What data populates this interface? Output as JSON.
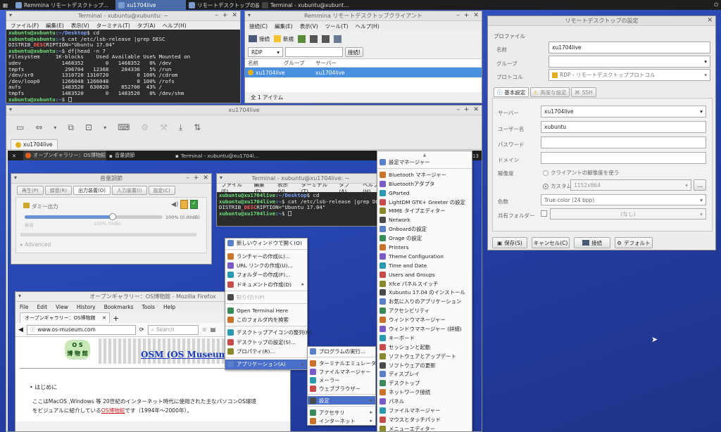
{
  "taskbar": {
    "items": [
      "Remmina リモートデスクトップ...",
      "xu1704live",
      "リモートデスクトップの設定",
      "Terminal - xubuntu@xubunt..."
    ]
  },
  "term1": {
    "title": "Terminal - xubuntu@xubuntu: ~",
    "menu": [
      "ファイル(F)",
      "編集(E)",
      "表示(V)",
      "ターミナル(T)",
      "タブ(A)",
      "ヘルプ(H)"
    ],
    "lines": [
      {
        "user": "xubuntu@xubuntu",
        "path": ":~/Desktop",
        "cmd": "$ cd"
      },
      {
        "user": "xubuntu@xubuntu",
        "path": ":~",
        "cmd": "$ cat /etc/lsb-release |grep DESC"
      },
      {
        "plain_a": "DISTRIB_",
        "plain_b": "DESC",
        "plain_c": "RIPTION=\"Ubuntu 17.04\""
      },
      {
        "user": "xubuntu@xubuntu",
        "path": ":~",
        "cmd": "$ df|head -n 7"
      },
      {
        "plain": "Filesystem     1K-blocks    Used Available Use% Mounted on"
      },
      {
        "plain": "udev             1468352       0   1468352   0% /dev"
      },
      {
        "plain": "tmpfs             296704   12368    284336   5% /run"
      },
      {
        "plain": "/dev/sr0         1310720 1310720         0 100% /cdrom"
      },
      {
        "plain": "/dev/loop0       1266048 1266048         0 100% /rofs"
      },
      {
        "plain": "aufs             1483520  630820    852700  43% /"
      },
      {
        "plain": "tmpfs            1483520       0   1483520   0% /dev/shm"
      },
      {
        "user": "xubuntu@xubuntu",
        "path": ":~",
        "cmd": "$ "
      }
    ]
  },
  "remmina": {
    "title": "Remmina リモートデスクトップクライアント",
    "menu": [
      "接続(C)",
      "編集(E)",
      "表示(V)",
      "ツール(T)",
      "ヘルプ(H)"
    ],
    "toolbar": {
      "connect": "接続",
      "new": "新規"
    },
    "protocol": "RDP",
    "connect_btn": "接続!",
    "columns": [
      "名前",
      "グループ",
      "サーバー"
    ],
    "row": {
      "name": "xu1704live",
      "group": "",
      "server": "xu1704live"
    },
    "status": "全 1 アイテム"
  },
  "prefs": {
    "title": "リモートデスクトップの設定",
    "profile_header": "プロファイル",
    "name_label": "名前",
    "name_value": "xu1704live",
    "group_label": "グループ",
    "protocol_label": "プロトコル",
    "protocol_value": "RDP - リモートデスクトッププロトコル",
    "tabs": [
      "基本設定",
      "高度な設定",
      "SSH"
    ],
    "server_label": "サーバー",
    "server_value": "xu1704live",
    "user_label": "ユーザー名",
    "user_value": "xubuntu",
    "password_label": "パスワード",
    "domain_label": "ドメイン",
    "resolution_label": "解像度",
    "res_client": "クライアントの解像度を使う",
    "res_custom": "カスタム",
    "res_value": "1152x864",
    "res_more": "...",
    "color_label": "色数",
    "color_value": "True color (24 bpp)",
    "shared_label": "共有フォルダー",
    "shared_value": "(なし)",
    "buttons": {
      "save": "保存(S)",
      "cancel": "キャンセル(C)",
      "connect": "接続",
      "default": "デフォルト"
    }
  },
  "remote": {
    "title": "xu1704live",
    "tab": "xu1704live",
    "inner_taskbar": [
      "オープンギャラリー：OS博物館 -...",
      "音量調節",
      "Terminal - xubuntu@xu1704l..."
    ],
    "clock": "11:13",
    "volume": {
      "title": "音量調節",
      "tabs": [
        "再生(P)",
        "録音(R)",
        "出力装置(O)",
        "入力装置(I)",
        "設定(C)"
      ],
      "device": "ダミー出力",
      "level_text": "100% (0.00dB)",
      "left_text": "無音",
      "mid_text": "100% (0dB)",
      "advanced": "Advanced",
      "level": 1.0
    },
    "term2": {
      "title": "Terminal - xubuntu@xu1704live: ~",
      "menu": [
        "ファイル(F)",
        "編集(E)",
        "表示(V)",
        "ターミナル(T)",
        "タブ(A)",
        "ヘルプ(H)"
      ],
      "lines": [
        {
          "user": "xubuntu@xu1704live",
          "path": ":~/Desktop",
          "cmd": "$ cd"
        },
        {
          "user": "xubuntu@xu1704live",
          "path": ":~",
          "cmd": "$ cat /etc/lsb-release |grep DESC"
        },
        {
          "plain_a": "DISTRIB_",
          "plain_b": "DESC",
          "plain_c": "RIPTION=\"Ubuntu 17.04\""
        },
        {
          "user": "xubuntu@xu1704live",
          "path": ":~",
          "cmd": "$ "
        }
      ]
    },
    "firefox": {
      "title": "オープンギャラリー：OS博物館 - Mozilla Firefox",
      "menu": [
        "File",
        "Edit",
        "View",
        "History",
        "Bookmarks",
        "Tools",
        "Help"
      ],
      "tab": "オープンギャラリー：OS博物館",
      "url": "www.os-museum.com",
      "search_placeholder": "Search",
      "logo_top": "O S",
      "logo_bottom": "博 物 館",
      "banner": "OSM (OS Museum)",
      "bullet": "はじめに",
      "body1": "ここはMacOS ,Windows 等 20世紀のインターネット時代に使用された主なパソコンOS環境",
      "body2a": "をビジュアルに紹介している",
      "body2b": "OS博物館",
      "body2c": "です（1994年～2000年）。"
    },
    "desktop_menu": {
      "items": [
        {
          "label": "新しいウィンドウで開く(O)",
          "icon": "folder-icon"
        },
        {
          "sep": true
        },
        {
          "label": "ランチャーの作成(L)...",
          "icon": "launcher-icon"
        },
        {
          "label": "URL リンクの作成(U)...",
          "icon": "link-icon"
        },
        {
          "label": "フォルダーの作成(F)...",
          "icon": "folder-icon"
        },
        {
          "label": "ドキュメントの作成(D)",
          "icon": "document-icon",
          "sub": true
        },
        {
          "sep": true
        },
        {
          "label": "貼り付け(P)",
          "icon": "paste-icon",
          "disabled": true
        },
        {
          "sep": true
        },
        {
          "label": "Open Terminal Here",
          "icon": "terminal-icon"
        },
        {
          "label": "このフォルダ内を検索",
          "icon": "search-icon"
        },
        {
          "sep": true
        },
        {
          "label": "デスクトップアイコンの整列(R)",
          "icon": "arrange-icon"
        },
        {
          "label": "デスクトップの設定(S)...",
          "icon": "desktop-icon"
        },
        {
          "label": "プロパティ(R)...",
          "icon": "properties-icon"
        },
        {
          "sep": true
        },
        {
          "label": "アプリケーション(A)",
          "icon": "applications-icon",
          "sub": true,
          "selected": true
        }
      ]
    },
    "apps_menu": {
      "items": [
        {
          "label": "プログラムの実行...",
          "icon": "run-icon"
        },
        {
          "sep": true
        },
        {
          "label": "ターミナルエミュレーター",
          "icon": "terminal-icon"
        },
        {
          "label": "ファイルマネージャー",
          "icon": "file-manager-icon"
        },
        {
          "label": "メーラー",
          "icon": "mail-icon"
        },
        {
          "label": "ウェブブラウザー",
          "icon": "browser-icon"
        },
        {
          "sep": true
        },
        {
          "label": "設定",
          "icon": "settings-icon",
          "sub": true,
          "selected": true
        },
        {
          "sep": true
        },
        {
          "label": "アクセサリ",
          "icon": "accessories-icon",
          "sub": true
        },
        {
          "label": "インターネット",
          "icon": "internet-icon",
          "sub": true
        }
      ]
    },
    "settings_menu": {
      "items": [
        {
          "label": "設定マネージャー",
          "icon": "settings-manager-icon"
        },
        {
          "sep": true
        },
        {
          "label": "Bluetooth マネージャー",
          "icon": "bluetooth-icon"
        },
        {
          "label": "Bluetoothアダプタ",
          "icon": "bluetooth-icon"
        },
        {
          "label": "GParted",
          "icon": "gparted-icon"
        },
        {
          "label": "LightDM GTK+ Greeter の設定",
          "icon": "lightdm-icon"
        },
        {
          "label": "MIME タイプエディター",
          "icon": "mime-icon"
        },
        {
          "label": "Network",
          "icon": "network-icon"
        },
        {
          "label": "Onboardの設定",
          "icon": "keyboard-icon"
        },
        {
          "label": "Orage の設定",
          "icon": "calendar-icon"
        },
        {
          "label": "Printers",
          "icon": "printer-icon"
        },
        {
          "label": "Theme Configuration",
          "icon": "theme-icon"
        },
        {
          "label": "Time and Date",
          "icon": "clock-icon"
        },
        {
          "label": "Users and Groups",
          "icon": "users-icon"
        },
        {
          "label": "Xfce パネルスイッチ",
          "icon": "panel-switch-icon"
        },
        {
          "label": "Xubuntu 17.04 のインストール",
          "icon": "install-icon"
        },
        {
          "label": "お気に入りのアプリケーション",
          "icon": "favorites-icon"
        },
        {
          "label": "アクセシビリティ",
          "icon": "accessibility-icon"
        },
        {
          "label": "ウィンドウマネージャー",
          "icon": "window-manager-icon"
        },
        {
          "label": "ウィンドウマネージャー (詳細)",
          "icon": "window-manager-icon"
        },
        {
          "label": "キーボード",
          "icon": "keyboard-icon"
        },
        {
          "label": "セッションと起動",
          "icon": "session-icon"
        },
        {
          "label": "ソフトウェアとアップデート",
          "icon": "software-icon"
        },
        {
          "label": "ソフトウェアの更新",
          "icon": "update-icon"
        },
        {
          "label": "ディスプレイ",
          "icon": "display-icon"
        },
        {
          "label": "デスクトップ",
          "icon": "desktop-icon"
        },
        {
          "label": "ネットワーク接続",
          "icon": "network-icon"
        },
        {
          "label": "パネル",
          "icon": "panel-icon"
        },
        {
          "label": "ファイルマネージャー",
          "icon": "file-manager-icon"
        },
        {
          "label": "マウスとタッチパッド",
          "icon": "mouse-icon"
        },
        {
          "label": "メニューエディター",
          "icon": "menu-editor-icon"
        }
      ]
    }
  },
  "colors": {
    "selection": "#4a6fc9",
    "terminal_bg": "#2b2b2b",
    "desktop": "#2a48b3",
    "prompt_green": "#6ee07a",
    "prompt_blue": "#7aa4ff"
  }
}
